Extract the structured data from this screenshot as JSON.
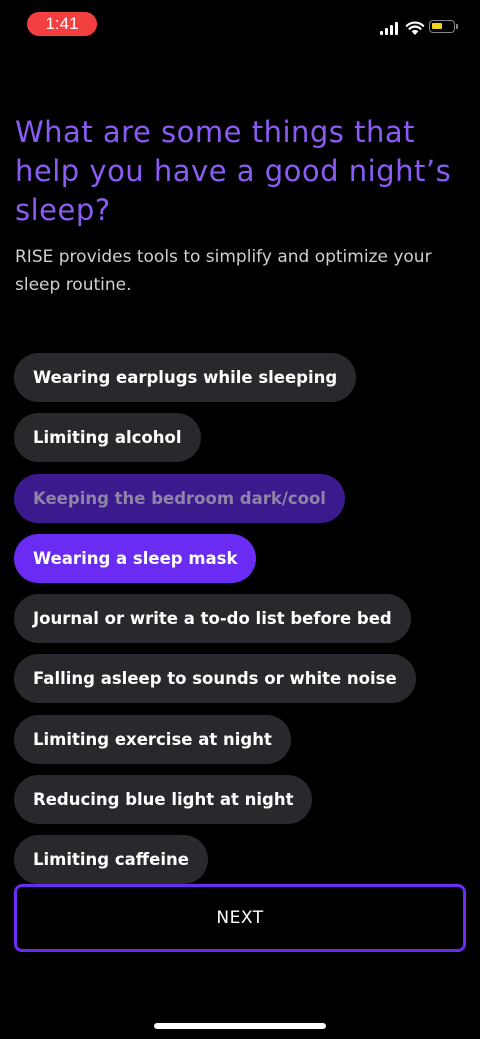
{
  "status_bar": {
    "time": "1:41",
    "icons": [
      "cellular-signal-icon",
      "wifi-icon",
      "battery-icon"
    ],
    "battery_color": "#f4d21f",
    "time_pill_color": "#f24040"
  },
  "question": {
    "title": "What are some things that help you have a good night’s sleep?",
    "subtitle": "RISE provides tools to simplify and optimize your sleep routine."
  },
  "options": [
    {
      "label": "Wearing earplugs while sleeping",
      "selected": false
    },
    {
      "label": "Limiting alcohol",
      "selected": false
    },
    {
      "label": "Keeping the bedroom dark/cool",
      "selected": true,
      "state": "pressed"
    },
    {
      "label": "Wearing a sleep mask",
      "selected": true
    },
    {
      "label": "Journal or write a to-do list before bed",
      "selected": false
    },
    {
      "label": "Falling asleep to sounds or white noise",
      "selected": false
    },
    {
      "label": "Limiting exercise at night",
      "selected": false
    },
    {
      "label": "Reducing blue light at night",
      "selected": false
    },
    {
      "label": "Limiting caffeine",
      "selected": false
    }
  ],
  "next_button": {
    "label": "NEXT"
  },
  "colors": {
    "accent": "#6a2cf2",
    "title": "#8a5cf4",
    "chip": "#2a282c",
    "background": "#000000"
  }
}
